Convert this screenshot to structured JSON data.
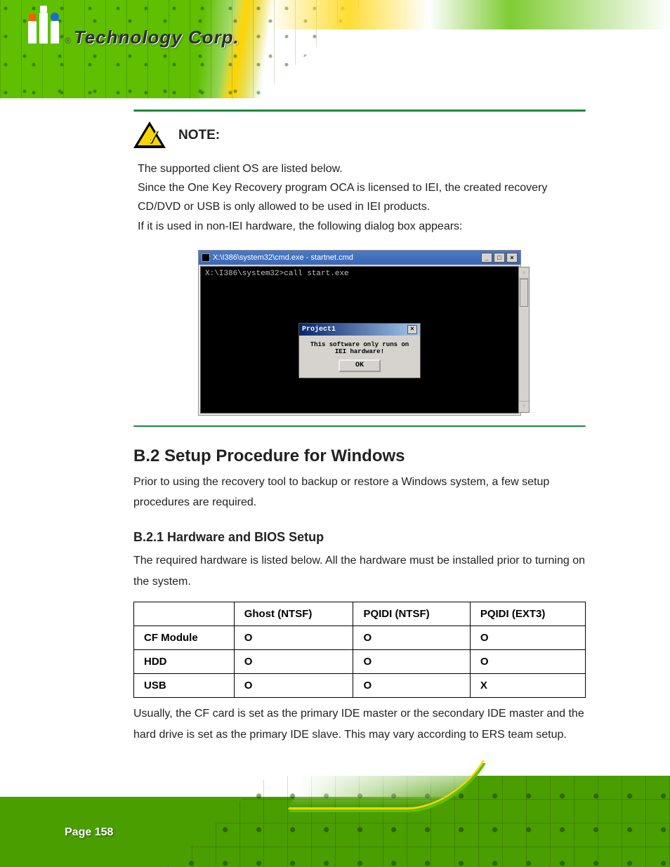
{
  "logo": {
    "brand": "Technology Corp."
  },
  "note": {
    "label": "NOTE:",
    "body": "The supported client OS are listed below.\nSince the One Key Recovery program OCA is licensed to IEI, the created recovery CD/DVD or USB is only allowed to be used in IEI products.\nIf it is used in non-IEI hardware, the following dialog box appears:"
  },
  "cmd": {
    "title": "X:\\I386\\system32\\cmd.exe - startnet.cmd",
    "prompt": "X:\\I386\\system32>call start.exe",
    "win_buttons": {
      "min": "_",
      "max": "□",
      "close": "×"
    },
    "dlg": {
      "title": "Project1",
      "msg": "This software only runs on IEI hardware!",
      "ok": "OK",
      "close": "×"
    }
  },
  "section": {
    "h2": "B.2 Setup Procedure for Windows",
    "p1": "Prior to using the recovery tool to backup or restore a Windows system, a few setup procedures are required.",
    "h3": "B.2.1 Hardware and BIOS Setup",
    "p2": "The required hardware is listed below. All the hardware must be installed prior to turning on the system."
  },
  "table": {
    "headers": [
      "",
      "Ghost (NTSF)",
      "PQIDI (NTSF)",
      "PQIDI (EXT3)"
    ],
    "rows": [
      [
        "CF Module",
        "O",
        "O",
        "O"
      ],
      [
        "HDD",
        "O",
        "O",
        "O"
      ],
      [
        "USB",
        "O",
        "O",
        "X"
      ]
    ]
  },
  "p3": "Usually, the CF card is set as the primary IDE master or the secondary IDE master and the hard drive is set as the primary IDE slave. This may vary according to ERS team setup.",
  "page_number": "Page 158"
}
